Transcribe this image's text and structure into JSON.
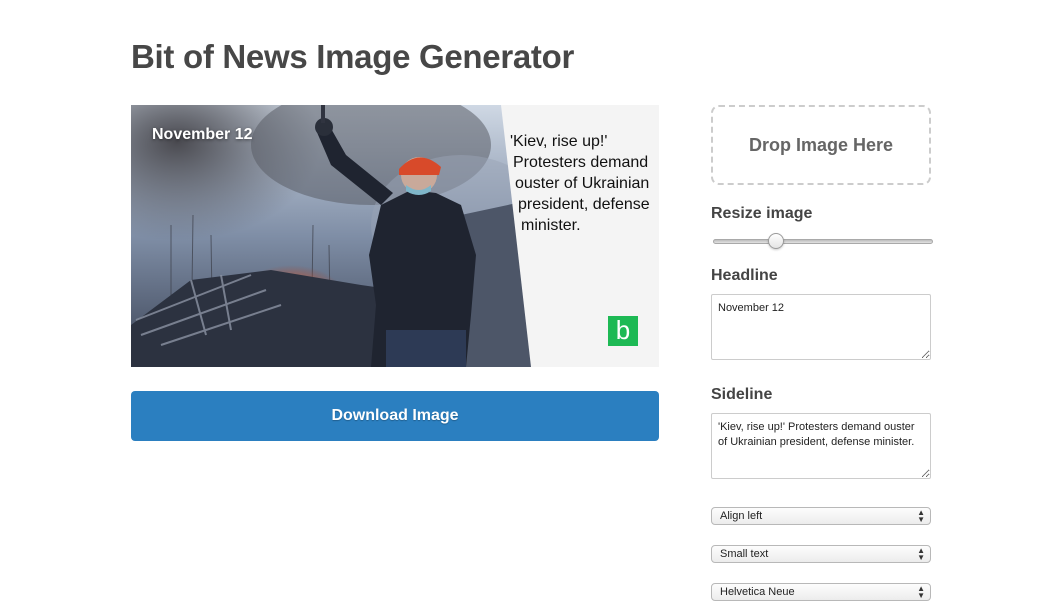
{
  "page": {
    "title": "Bit of News Image Generator"
  },
  "preview": {
    "headline": "November 12",
    "sideline_lines": [
      "'Kiev, rise up!'",
      "Protesters demand",
      "ouster of Ukrainian",
      "president, defense",
      "minister."
    ],
    "logo_letter": "b",
    "logo_color": "#1db954"
  },
  "actions": {
    "download_label": "Download Image",
    "download_color": "#2b7fc0"
  },
  "controls": {
    "drop_zone_label": "Drop Image Here",
    "resize_label": "Resize image",
    "resize_value": 0.27,
    "headline_label": "Headline",
    "headline_value": "November 12",
    "sideline_label": "Sideline",
    "sideline_value": "'Kiev, rise up!' Protesters demand ouster of Ukrainian president, defense minister.",
    "align_selected": "Align left",
    "size_selected": "Small text",
    "font_selected": "Helvetica Neue"
  }
}
